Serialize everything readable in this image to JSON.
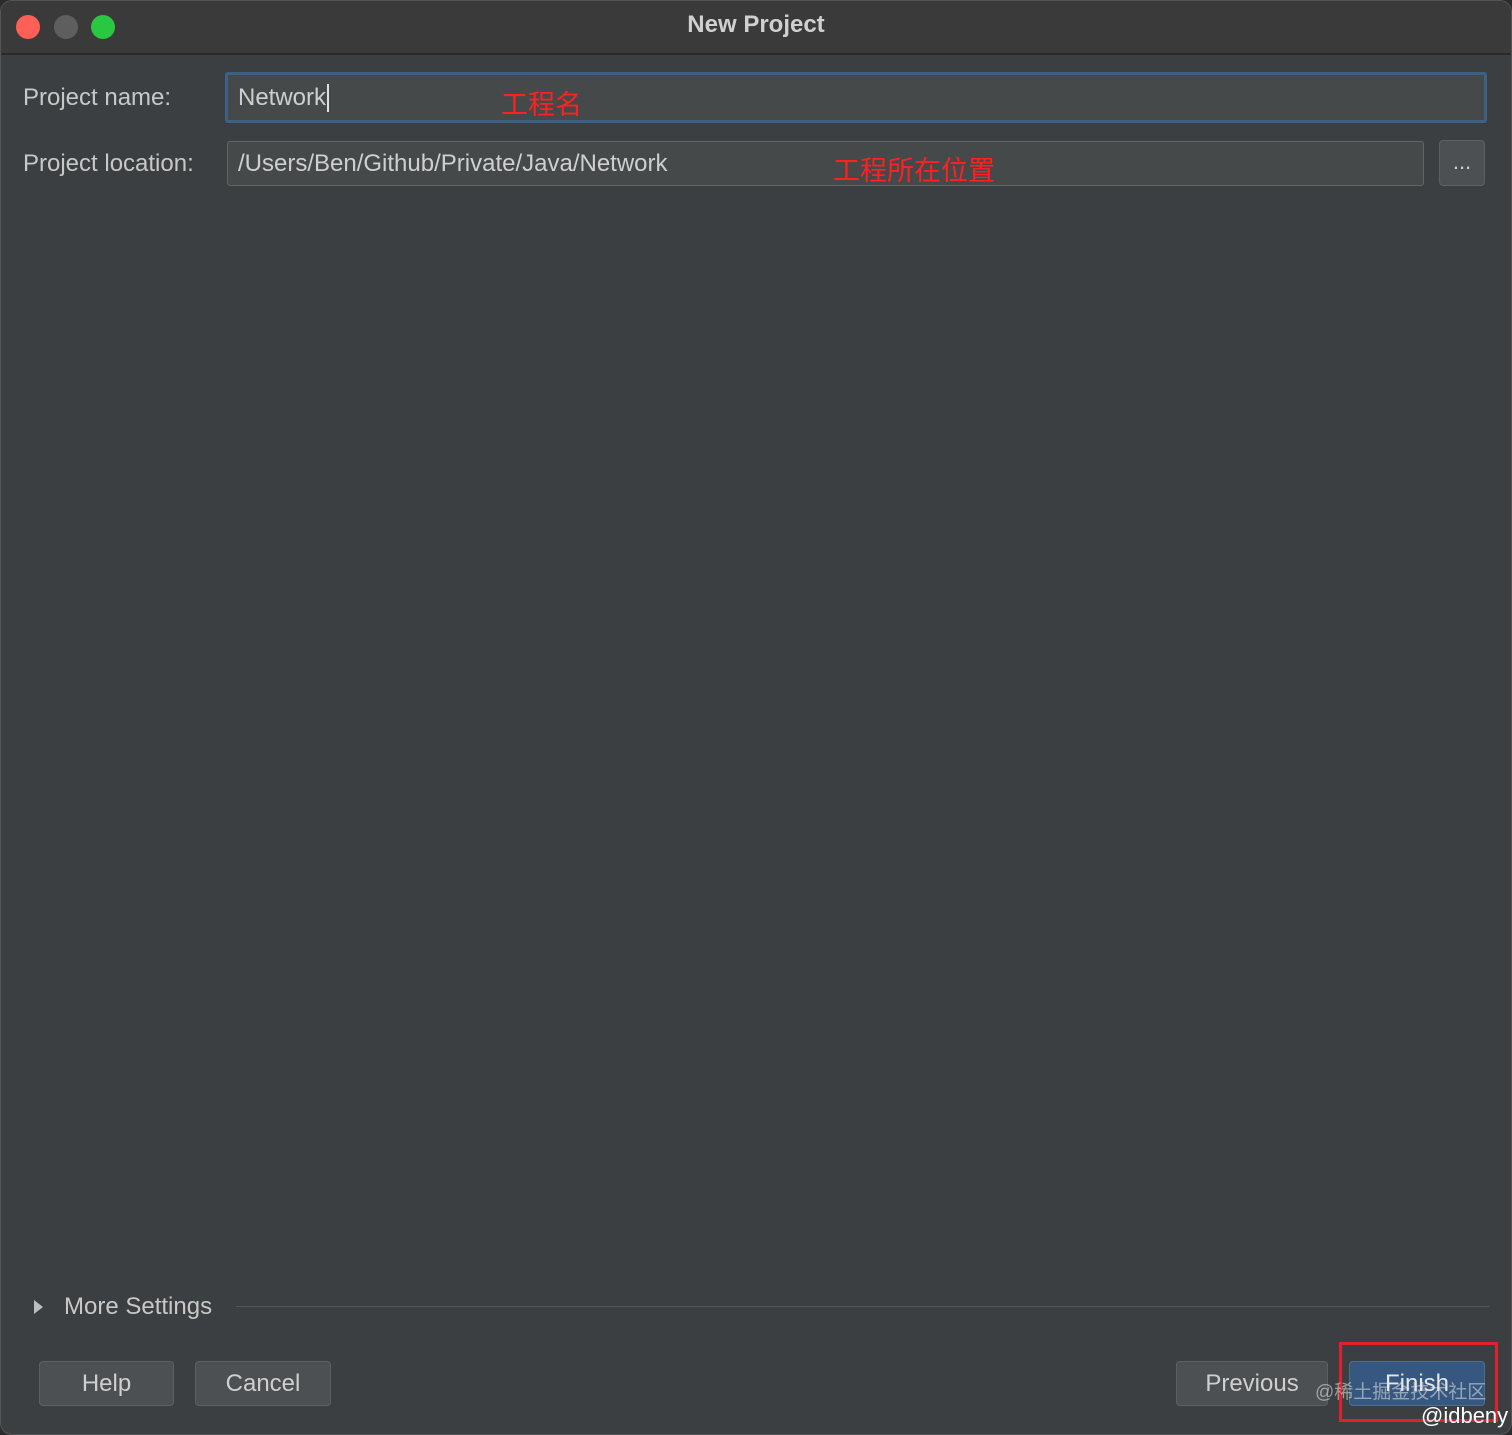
{
  "window": {
    "title": "New Project"
  },
  "form": {
    "name_label": "Project name:",
    "name_value": "Network",
    "location_label": "Project location:",
    "location_value": "/Users/Ben/Github/Private/Java/Network",
    "browse_label": "..."
  },
  "annotations": {
    "name_note": "工程名",
    "location_note": "工程所在位置",
    "color": "#ff2020"
  },
  "more_settings": {
    "label": "More Settings",
    "icon": "triangle-right-icon"
  },
  "footer": {
    "help_label": "Help",
    "cancel_label": "Cancel",
    "previous_label": "Previous",
    "finish_label": "Finish"
  },
  "watermarks": {
    "site": "@稀土掘金技术社区",
    "author": "@idbeny"
  },
  "colors": {
    "background": "#3c3f41",
    "accent": "#365880",
    "focus_border": "#3d6185",
    "close": "#fe5f57",
    "maximize": "#2ac840"
  }
}
